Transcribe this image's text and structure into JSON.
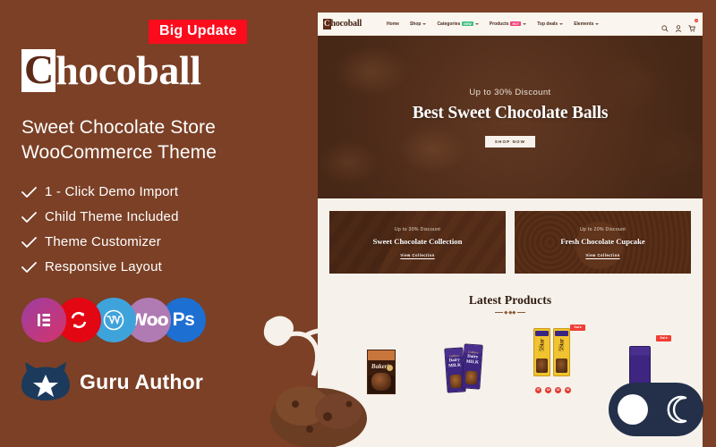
{
  "promo": {
    "badge": "Big Update",
    "brand_initial": "C",
    "brand_rest": "hocoball",
    "tagline_line1": "Sweet Chocolate Store",
    "tagline_line2": "WooCommerce Theme",
    "features": [
      "1 - Click Demo Import",
      "Child Theme Included",
      "Theme Customizer",
      "Responsive Layout"
    ],
    "tech_badges": [
      {
        "name": "elementor",
        "label": ""
      },
      {
        "name": "revolution-slider",
        "label": ""
      },
      {
        "name": "wordpress",
        "label": ""
      },
      {
        "name": "woocommerce",
        "label": "Woo"
      },
      {
        "name": "photoshop",
        "label": "Ps"
      }
    ],
    "author_label": "Guru Author",
    "colors": {
      "background": "#7b4026",
      "badge": "#fb0c1c",
      "text": "#ffffff",
      "author_badge": "#1b3a5c"
    }
  },
  "site": {
    "logo_initial": "C",
    "logo_rest": "hocoball",
    "nav": [
      {
        "label": "Home",
        "badge": "",
        "caret": false
      },
      {
        "label": "Shop",
        "badge": "",
        "caret": true
      },
      {
        "label": "Categories",
        "badge": "NEW",
        "caret": true
      },
      {
        "label": "Products",
        "badge": "HOT",
        "caret": true
      },
      {
        "label": "Top deals",
        "badge": "",
        "caret": true
      },
      {
        "label": "Elements",
        "badge": "",
        "caret": true
      }
    ],
    "header_icons": [
      "search-icon",
      "account-icon",
      "cart-icon"
    ],
    "cart_count": "0",
    "hero": {
      "subtitle": "Up to 30% Discount",
      "title": "Best Sweet Chocolate Balls",
      "button": "SHOP NOW"
    },
    "promo_cards": [
      {
        "subtitle": "Up to 30% Discount",
        "title": "Sweet Chocolate Collection",
        "link": "View Collection"
      },
      {
        "subtitle": "Up to 20% Discount",
        "title": "Fresh Chocolate Cupcake",
        "link": "View Collection"
      }
    ],
    "section_title": "Latest Products",
    "products": [
      {
        "name": "bakers-chocolate",
        "sale": "",
        "brand_top": "PREMIUM BAKING",
        "brand": "Baker's"
      },
      {
        "name": "dairy-milk",
        "sale": "",
        "brand_top": "Cadbury",
        "brand": "Dairy MILK"
      },
      {
        "name": "five-star",
        "sale": "Sale",
        "brand_top": "",
        "brand": "5Star"
      },
      {
        "name": "cadbury-bar",
        "sale": "Sale",
        "brand_top": "",
        "brand": ""
      }
    ],
    "countdown": [
      "07",
      "18",
      "22",
      "53"
    ],
    "colors": {
      "page_bg": "#f6f1ea",
      "sale_badge": "#ef3e36",
      "badge_green": "#3fbf7f",
      "badge_pink": "#f0407a"
    }
  },
  "dark_toggle": {
    "sun_icon": "sun-icon",
    "moon_icon": "moon-icon"
  }
}
